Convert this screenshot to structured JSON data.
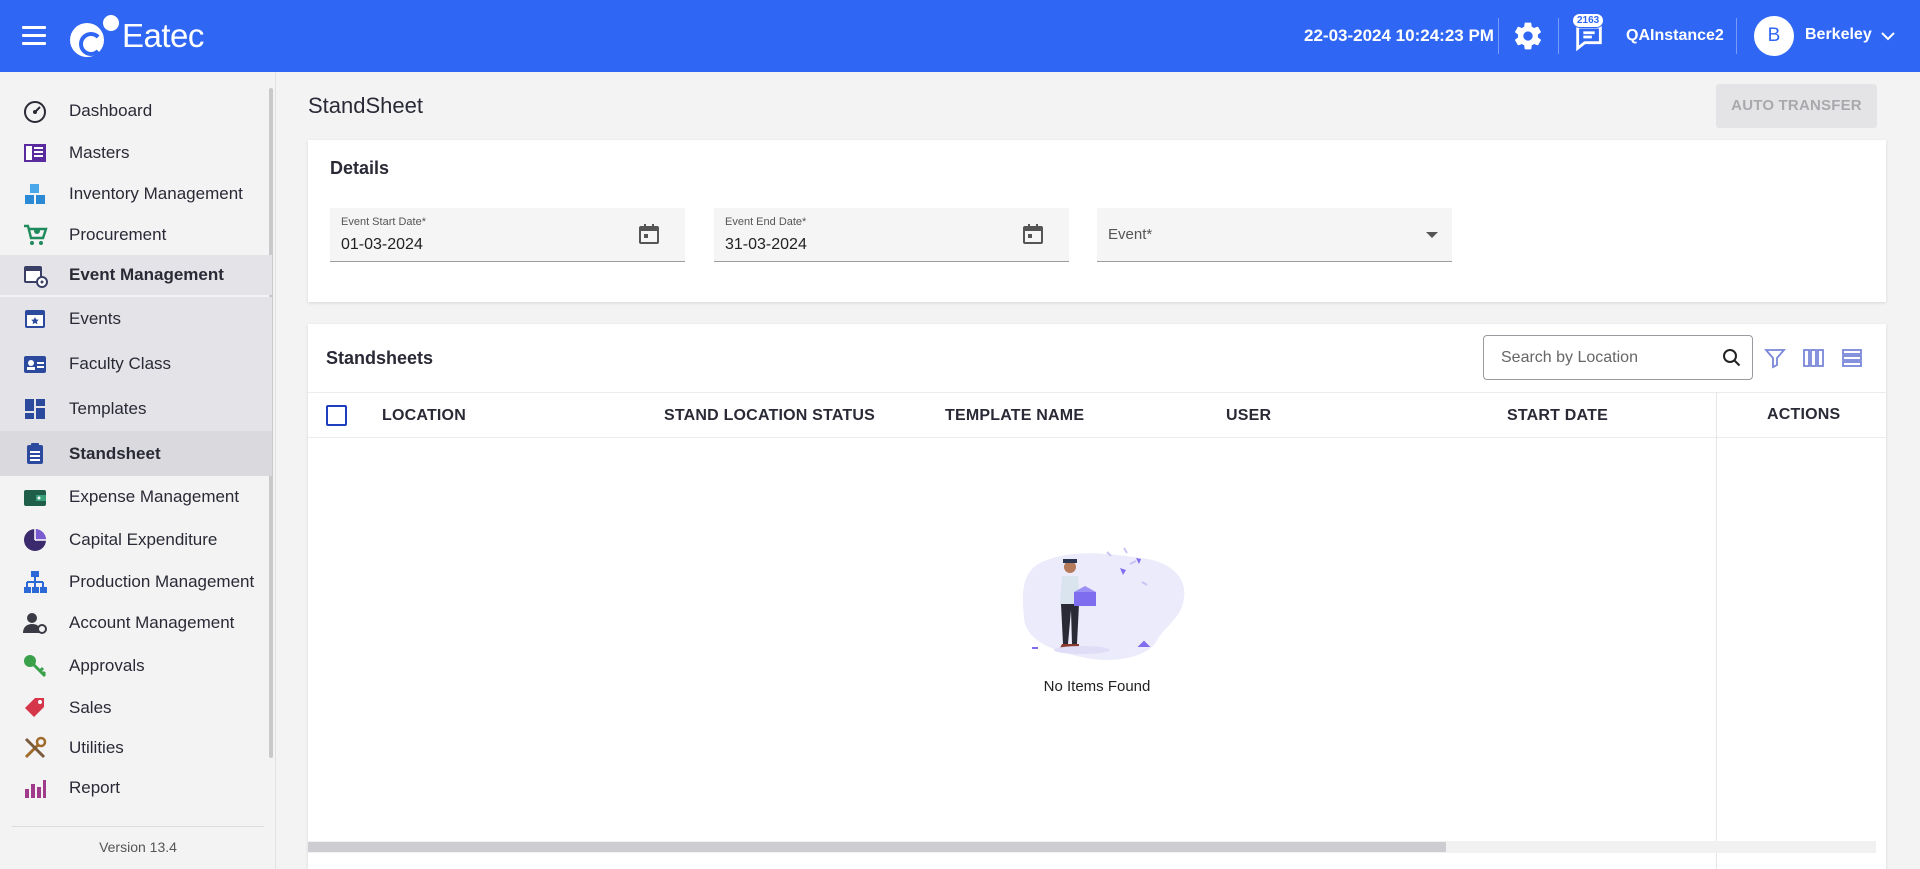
{
  "app": {
    "brand": "Eatec",
    "datetime": "22-03-2024 10:24:23 PM",
    "notification_count": "2163",
    "instance": "QAInstance2",
    "user_initial": "B",
    "user_name": "Berkeley",
    "brand_color": "#2f66f4"
  },
  "sidebar": {
    "items": [
      {
        "label": "Dashboard",
        "icon": "speedometer-icon"
      },
      {
        "label": "Masters",
        "icon": "book-icon"
      },
      {
        "label": "Inventory Management",
        "icon": "boxes-icon"
      },
      {
        "label": "Procurement",
        "icon": "cart-icon"
      },
      {
        "label": "Event Management",
        "icon": "calendar-settings-icon"
      },
      {
        "label": "Events",
        "icon": "calendar-star-icon"
      },
      {
        "label": "Faculty Class",
        "icon": "id-card-icon"
      },
      {
        "label": "Templates",
        "icon": "dashboard-grid-icon"
      },
      {
        "label": "Standsheet",
        "icon": "clipboard-icon"
      },
      {
        "label": "Expense Management",
        "icon": "wallet-icon"
      },
      {
        "label": "Capital Expenditure",
        "icon": "pie-chart-icon"
      },
      {
        "label": "Production Management",
        "icon": "hierarchy-icon"
      },
      {
        "label": "Account Management",
        "icon": "user-gear-icon"
      },
      {
        "label": "Approvals",
        "icon": "key-icon"
      },
      {
        "label": "Sales",
        "icon": "tag-icon"
      },
      {
        "label": "Utilities",
        "icon": "tools-icon"
      },
      {
        "label": "Report",
        "icon": "bar-chart-icon"
      }
    ],
    "version": "Version 13.4"
  },
  "page": {
    "title": "StandSheet",
    "auto_transfer_label": "AUTO TRANSFER"
  },
  "details": {
    "title": "Details",
    "start_label": "Event Start Date*",
    "start_value": "01-03-2024",
    "end_label": "Event End Date*",
    "end_value": "31-03-2024",
    "event_label": "Event*"
  },
  "standsheets": {
    "title": "Standsheets",
    "search_placeholder": "Search by Location",
    "columns": [
      "LOCATION",
      "STAND LOCATION STATUS",
      "TEMPLATE NAME",
      "USER",
      "START DATE"
    ],
    "actions_header": "ACTIONS",
    "rows": [],
    "empty_text": "No Items Found"
  }
}
